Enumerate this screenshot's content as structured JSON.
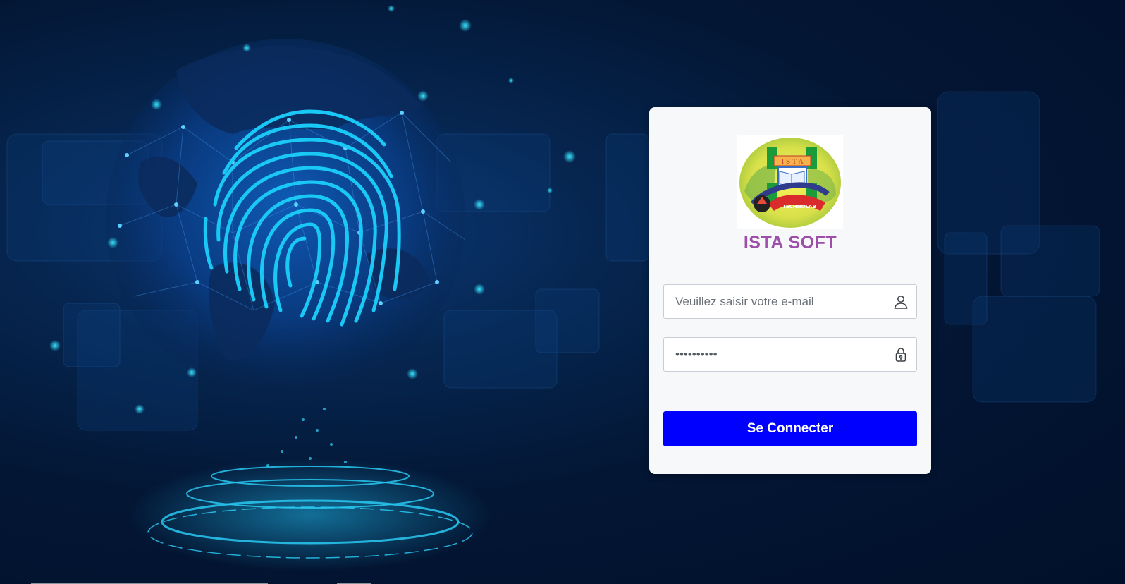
{
  "brand": {
    "name": "ISTA SOFT",
    "color": "#9c4ea9"
  },
  "logo": {
    "banner_text": "I S T A",
    "ribbon_text": "TECHNOLAB"
  },
  "login": {
    "email_placeholder": "Veuillez saisir votre e-mail",
    "password_value": "**********",
    "submit_label": "Se Connecter",
    "submit_color": "#0000fe"
  },
  "icons": {
    "email": "user-icon",
    "password": "lock-icon"
  },
  "background": {
    "theme": "fingerprint-globe-cyber",
    "accent": "#19c8f5"
  }
}
